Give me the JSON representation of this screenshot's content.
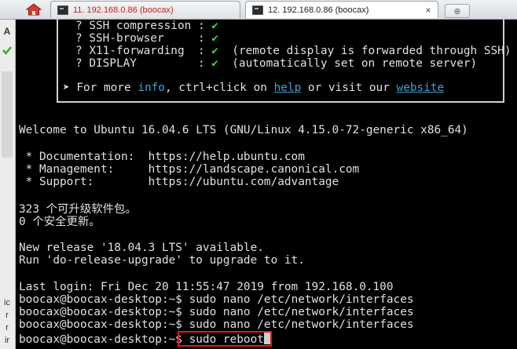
{
  "tabs": [
    {
      "label": "11. 192.168.0.86 (boocax)",
      "active": false,
      "color": "#c81e1e"
    },
    {
      "label": "12. 192.168.0.86 (boocax)",
      "active": true,
      "close": "×"
    }
  ],
  "left_strip": {
    "top_letter": "A",
    "bottom_letters": [
      "ic",
      "r",
      "r",
      "ir"
    ]
  },
  "infobox": {
    "lines": [
      {
        "label": "? SSH compression : ",
        "mark": "✔",
        "note": ""
      },
      {
        "label": "? SSH-browser     : ",
        "mark": "✔",
        "note": ""
      },
      {
        "label": "? X11-forwarding  : ",
        "mark": "✔",
        "note": "  (remote display is forwarded through SSH)"
      },
      {
        "label": "? DISPLAY         : ",
        "mark": "✔",
        "note": "  (automatically set on remote server)"
      }
    ],
    "footer": {
      "prefix": "➤ For more ",
      "info": "info",
      "mid1": ", ctrl+click on ",
      "help": "help",
      "mid2": " or visit our ",
      "website": "website"
    }
  },
  "terminal": {
    "welcome": "Welcome to Ubuntu 16.04.6 LTS (GNU/Linux 4.15.0-72-generic x86_64)",
    "docs": [
      " * Documentation:  https://help.ubuntu.com",
      " * Management:     https://landscape.canonical.com",
      " * Support:        https://ubuntu.com/advantage"
    ],
    "updates": [
      "323 个可升级软件包。",
      "0 个安全更新。"
    ],
    "release": [
      "New release '18.04.3 LTS' available.",
      "Run 'do-release-upgrade' to upgrade to it."
    ],
    "last_login": "Last login: Fri Dec 20 11:55:47 2019 from 192.168.0.100",
    "prompt": "boocax@boocax-desktop:~$ ",
    "history": [
      "sudo nano /etc/network/interfaces",
      "sudo nano /etc/network/interfaces",
      "sudo nano /etc/network/interfaces"
    ],
    "current_command": "sudo reboot"
  }
}
